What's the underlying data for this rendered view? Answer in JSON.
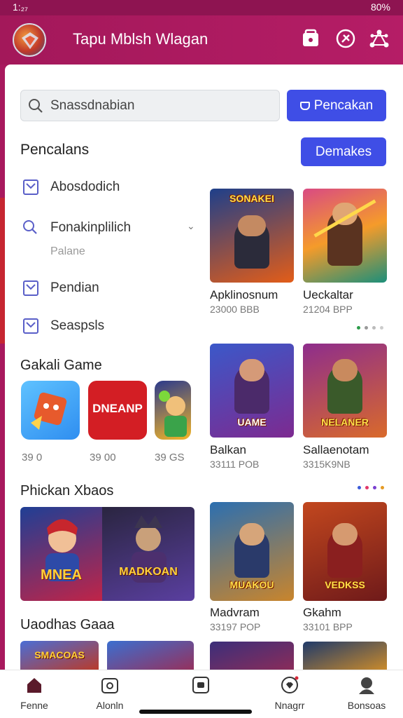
{
  "status": {
    "time": "1:₂₇",
    "battery": "80%"
  },
  "app": {
    "title": "Tapu Mblsh Wlagan"
  },
  "search": {
    "placeholder": "Snassdnabian",
    "button_label": "Pencakan"
  },
  "filters": {
    "title": "Pencalans",
    "apply_label": "Demakes",
    "options": [
      {
        "label": "Abosdodich",
        "checked": true,
        "icon": "checkbox-icon"
      },
      {
        "label": "Fonakinplilich",
        "sublabel": "Palane",
        "icon": "search-icon"
      },
      {
        "label": "Pendian",
        "checked": true,
        "icon": "checkbox-icon"
      },
      {
        "label": "Seaspsls",
        "checked": true,
        "icon": "checkbox-icon"
      }
    ]
  },
  "gakali": {
    "title": "Gakali Game",
    "games": [
      {
        "value": "39 0",
        "color": "#2f8ef0"
      },
      {
        "value": "39 00",
        "label": "DNEANP",
        "color": "#d31e24"
      },
      {
        "value": "39 GS",
        "color": "#f3b526"
      }
    ]
  },
  "phickan": {
    "title": "Phickan Xbaos",
    "banner_titles": [
      "MNEA",
      "MADKOAN"
    ]
  },
  "uaodhas": {
    "title": "Uaodhas Gaaa",
    "banner_titles": [
      "SMACOAS",
      ""
    ]
  },
  "cards": [
    {
      "title": "Apklinosnum",
      "price": "23000 BBB",
      "art": "SONAKEI",
      "c1": "#1e3f8a",
      "c2": "#e35d18"
    },
    {
      "title": "Ueckaltar",
      "price": "21204 BPP",
      "art": "",
      "c1": "#d94a83",
      "c2": "#1c8f7a"
    },
    {
      "title": "Balkan",
      "price": "33111 POB",
      "art": "UAME",
      "c1": "#3b58c9",
      "c2": "#7d2a90"
    },
    {
      "title": "Sallaenotam",
      "price": "3315K9NB",
      "art": "NELANER",
      "c1": "#8e2d8c",
      "c2": "#d96a2b"
    },
    {
      "title": "Madvram",
      "price": "33197 POP",
      "art": "MUAKOU",
      "c1": "#2c6fb0",
      "c2": "#c9852c"
    },
    {
      "title": "Gkahm",
      "price": "33101 BPP",
      "art": "VEDKSS",
      "c1": "#c2471e",
      "c2": "#6f1a1a"
    }
  ],
  "colors": {
    "brand": "#a8195e",
    "accent": "#3f4ee6"
  },
  "nav": [
    {
      "label": "Fenne",
      "icon": "home-icon"
    },
    {
      "label": "Alonln",
      "icon": "gamepad-icon"
    },
    {
      "label": "",
      "icon": "chat-icon"
    },
    {
      "label": "Nnagrr",
      "icon": "heart-icon"
    },
    {
      "label": "Bonsoas",
      "icon": "profile-icon"
    }
  ]
}
